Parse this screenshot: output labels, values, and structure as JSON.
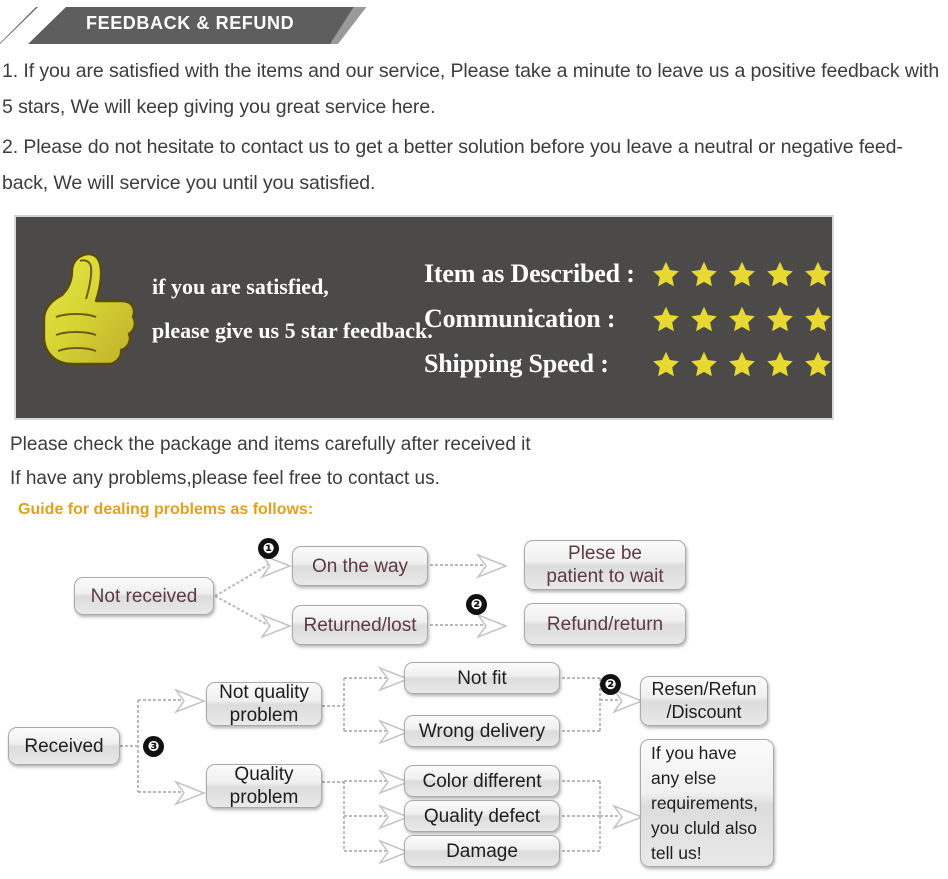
{
  "header": {
    "title": "FEEDBACK & REFUND",
    "banner_fill": "#5e5e5e",
    "banner_accent": "#9a9a9a",
    "text_color": "#ffffff"
  },
  "intro": {
    "paragraph_1": "1. If you are satisfied with the items and our service, Please take a minute to leave us a positive feedback with 5 stars, We will keep giving you great service here.",
    "paragraph_2": "2. Please do not hesitate to contact us to get a better solution before you leave a neutral or negative feed-back, We will service you until you satisfied."
  },
  "feedback_banner": {
    "background": "#4b4a48",
    "border": "#d8d8d8",
    "thumb_icon": "thumbs-up-icon",
    "thumb_color": "#d8d836",
    "line_1": "if you are satisfied,",
    "line_2": "please give us 5 star feedback.",
    "star_color": "#e8d832",
    "ratings": [
      {
        "label": "Item as Described :",
        "stars": 5
      },
      {
        "label": "Communication :",
        "stars": 5
      },
      {
        "label": "Shipping Speed :",
        "stars": 5
      }
    ]
  },
  "notes": {
    "line_1": "Please check the package and items carefully after received it",
    "line_2": "If have any problems,please feel free to contact us.",
    "guide": "Guide for dealing problems as follows:",
    "guide_color": "#e0a020"
  },
  "flowchart_1": {
    "source": "Not received",
    "badge_1": "❶",
    "badge_2": "❷",
    "branches": [
      {
        "status": "On the way",
        "action": "Plese be\npatient to wait"
      },
      {
        "status": "Returned/lost",
        "action": "Refund/return"
      }
    ],
    "box_text_color": "#5d3a42"
  },
  "flowchart_2": {
    "source": "Received",
    "badge_3": "❸",
    "badge_2": "❷",
    "categories": [
      {
        "label": "Not quality\nproblem",
        "issues": [
          "Not fit",
          "Wrong delivery"
        ]
      },
      {
        "label": "Quality\nproblem",
        "issues": [
          "Color different",
          "Quality defect",
          "Damage"
        ]
      }
    ],
    "outcomes": [
      "Resen/Refun\n/Discount",
      "If you have\nany else\nrequirements,\nyou cluld also\ntell us!"
    ],
    "box_text_color": "#1d1d1d"
  }
}
